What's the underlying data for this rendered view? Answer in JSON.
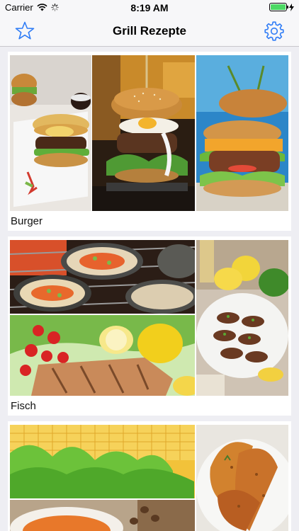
{
  "status_bar": {
    "carrier": "Carrier",
    "time": "8:19 AM"
  },
  "nav": {
    "title": "Grill Rezepte",
    "left_icon": "star-icon",
    "right_icon": "gear-icon",
    "accent": "#2f7cf6"
  },
  "categories": [
    {
      "label": "Burger"
    },
    {
      "label": "Fisch"
    },
    {
      "label": ""
    }
  ]
}
